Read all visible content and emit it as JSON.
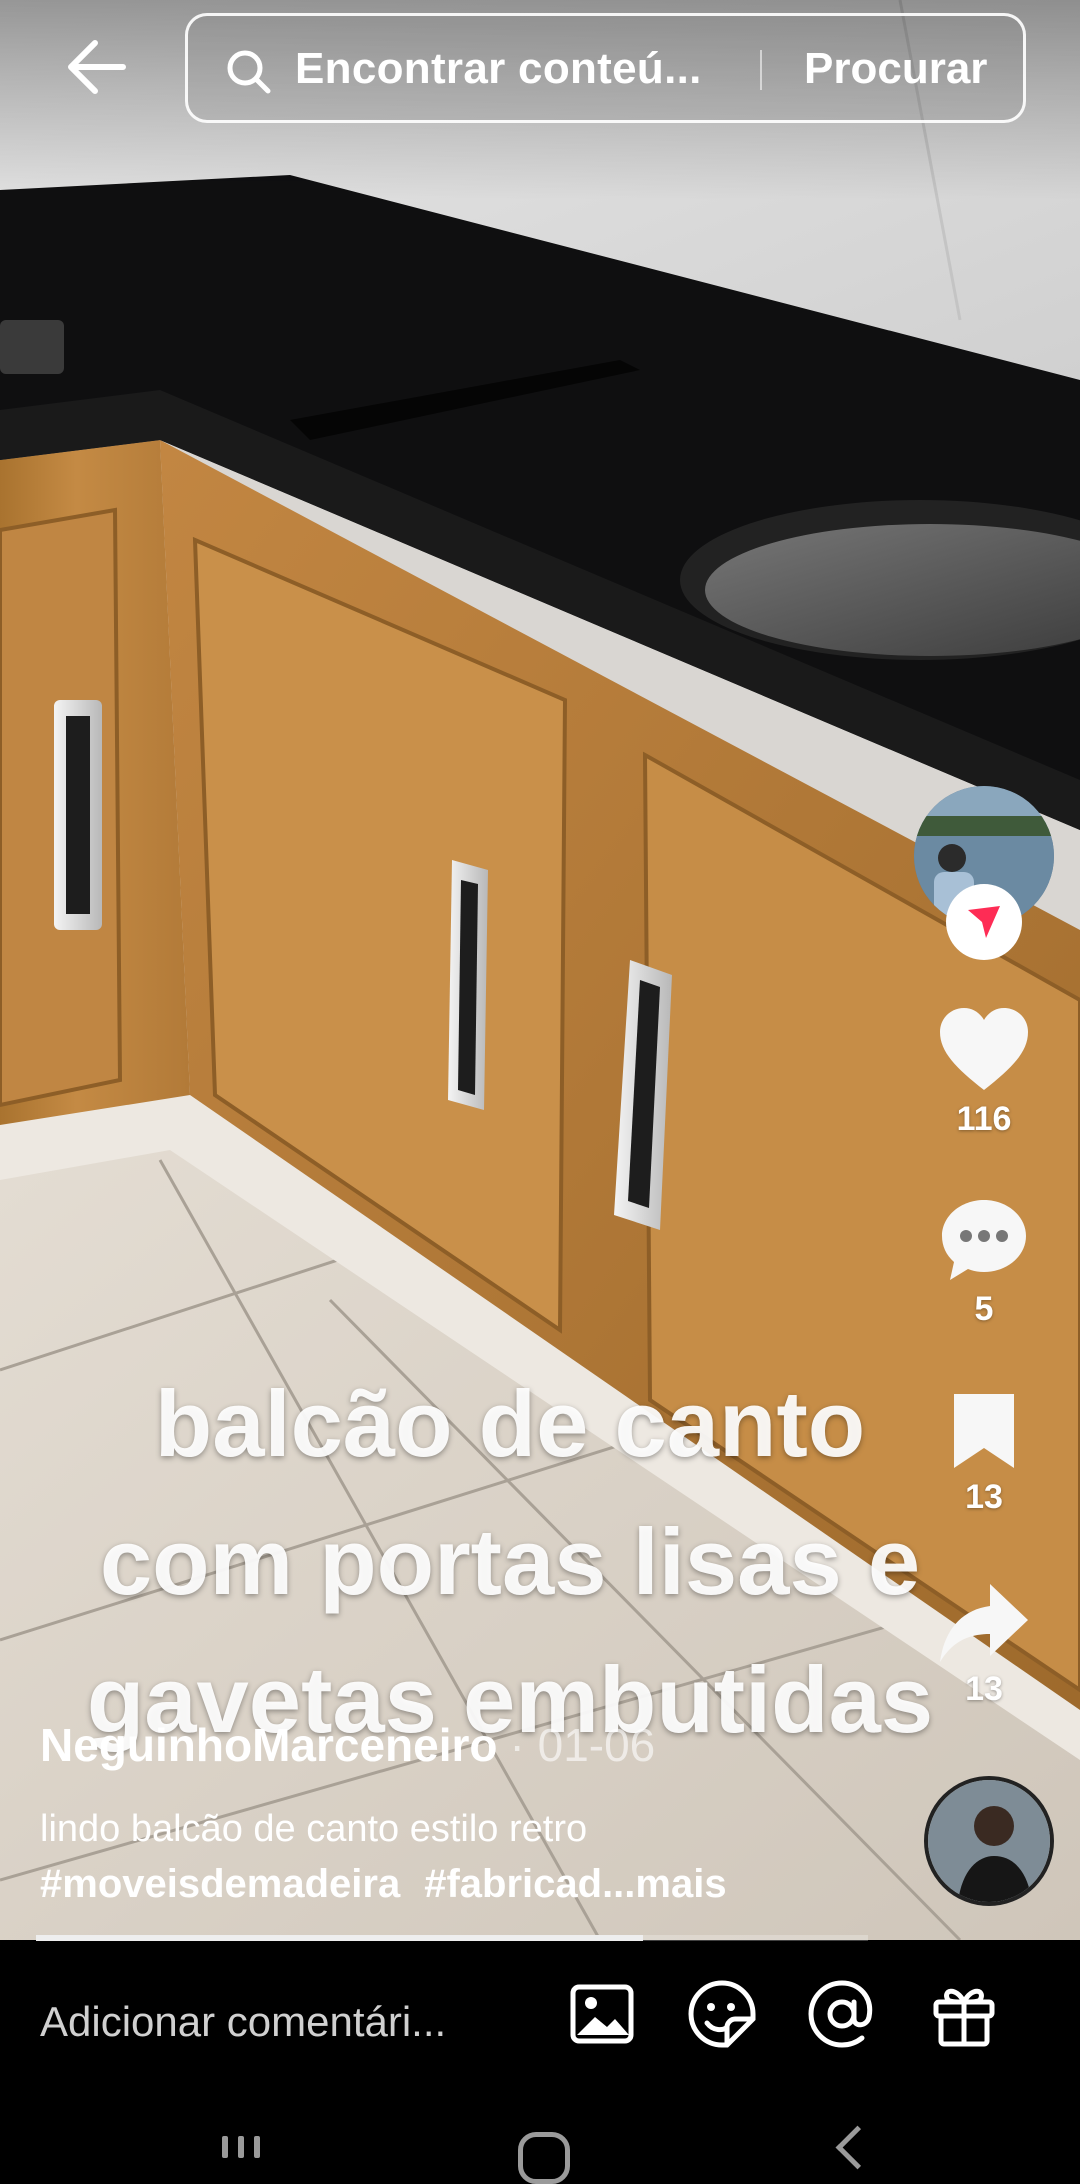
{
  "search": {
    "placeholder": "Encontrar conteú...",
    "button_label": "Procurar"
  },
  "video": {
    "overlay_lines": [
      "balcão de canto",
      "com portas lisas e",
      "gavetas embutidas"
    ]
  },
  "actions": {
    "likes": "116",
    "comments": "5",
    "saves": "13",
    "shares": "13"
  },
  "post": {
    "author": "NeguinhoMarceneiro",
    "date": "· 01-06",
    "description": "lindo balcão de canto estilo retro",
    "hashtags": [
      "#moveisdemadeira",
      "#fabricad"
    ],
    "more_label": "...mais",
    "progress": 0.73
  },
  "comment_bar": {
    "placeholder": "Adicionar comentári..."
  },
  "icons": {
    "back": "arrow-left-icon",
    "search": "search-icon",
    "like": "heart-icon",
    "comment": "comment-bubble-icon",
    "save": "bookmark-icon",
    "share": "share-arrow-icon",
    "image": "image-icon",
    "emoji": "emoji-sticker-icon",
    "mention": "at-sign-icon",
    "gift": "gift-icon"
  },
  "colors": {
    "follow_badge_accent": "#fe2c55",
    "background": "#000000"
  }
}
